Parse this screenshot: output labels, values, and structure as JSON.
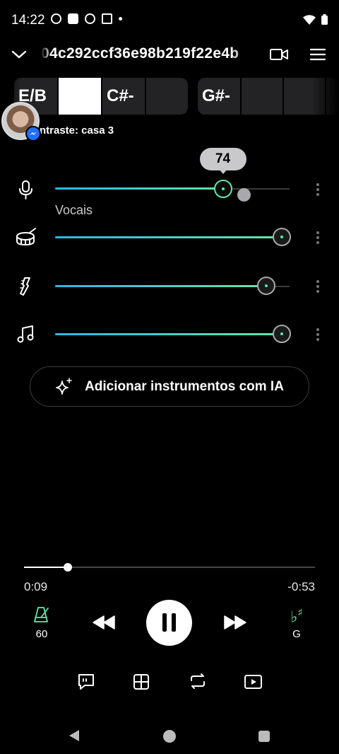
{
  "status_bar": {
    "time": "14:22"
  },
  "header": {
    "title": "04c292ccf36e98b219f22e4b"
  },
  "chords": {
    "group1": [
      "E/B",
      "",
      "C#-",
      ""
    ],
    "group2": [
      "G#-",
      "",
      "",
      ""
    ]
  },
  "contrast_label": "ntraste:  casa 3",
  "tracks": [
    {
      "name": "vocals",
      "label": "Vocais",
      "volume": 74,
      "icon": "microphone-icon"
    },
    {
      "name": "drums",
      "label": "",
      "volume": 100,
      "icon": "drum-icon"
    },
    {
      "name": "guitar",
      "label": "",
      "volume": 93,
      "icon": "guitar-icon"
    },
    {
      "name": "instruments",
      "label": "",
      "volume": 100,
      "icon": "music-note-icon"
    }
  ],
  "volume_tooltip": "74",
  "ai_button_label": "Adicionar instrumentos com IA",
  "playback": {
    "elapsed": "0:09",
    "remaining": "-0:53",
    "progress": 0.15
  },
  "metronome": {
    "value": "60"
  },
  "key": {
    "value": "G"
  },
  "colors": {
    "accent": "#5ee9a6",
    "accent_start": "#2ab8e6",
    "background": "#000000"
  }
}
